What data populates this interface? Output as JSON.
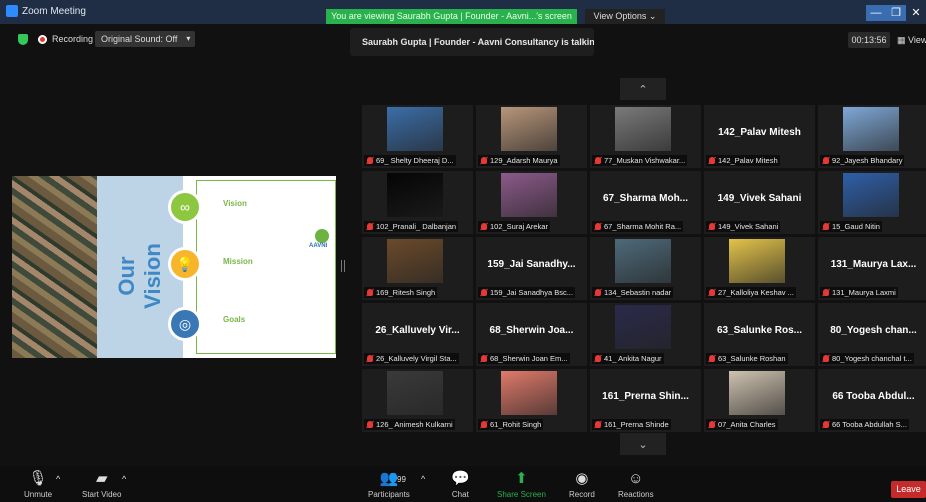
{
  "window": {
    "title": "Zoom Meeting",
    "banner": "You are viewing Saurabh Gupta | Founder - Aavni...'s screen",
    "view_options": "View Options",
    "minimize": "—",
    "maximize": "❐",
    "close": "✕"
  },
  "header": {
    "recording": "Recording",
    "original_sound": "Original Sound: Off",
    "talking": "Saurabh Gupta | Founder - Aavni Consultancy is talking...",
    "timer": "00:13:56",
    "view": "View"
  },
  "slide": {
    "title": "Our Vision",
    "brand": "AAVNI",
    "items": [
      {
        "title": "Vision",
        "icon": "binoculars-icon"
      },
      {
        "title": "Mission",
        "icon": "lightbulb-icon"
      },
      {
        "title": "Goals",
        "icon": "target-icon"
      }
    ]
  },
  "gallery": {
    "up": "⌃",
    "down": "⌄",
    "tiles": [
      {
        "name": "69_ Shelty Dheeraj D...",
        "photo": "#3b6ea8"
      },
      {
        "name": "129_Adarsh Maurya",
        "photo": "#b8967a"
      },
      {
        "name": "77_Muskan Vishwakar...",
        "photo": "#7a7a7a"
      },
      {
        "name": "142_Palav Mitesh",
        "big": "142_Palav Mitesh"
      },
      {
        "name": "92_Jayesh Bhandary",
        "photo": "#7fa8d6"
      },
      {
        "name": "102_Pranali_ Dalbanjan",
        "photo": "#050505"
      },
      {
        "name": "102_Suraj Arekar",
        "photo": "#8c5a8a"
      },
      {
        "name": "67_Sharma Mohit Ra...",
        "big": "67_Sharma Moh..."
      },
      {
        "name": "149_Vivek Sahani",
        "big": "149_Vivek Sahani"
      },
      {
        "name": "15_Gaud Nitin",
        "photo": "#2f5fa8"
      },
      {
        "name": "169_Ritesh Singh",
        "photo": "#6b4a2a"
      },
      {
        "name": "159_Jai Sanadhya Bsc...",
        "big": "159_Jai Sanadhy..."
      },
      {
        "name": "134_Sebastin nadar",
        "photo": "#4e6a7a"
      },
      {
        "name": "27_Kalloliya Keshav ...",
        "photo": "#e3c34a"
      },
      {
        "name": "131_Maurya Laxmi",
        "big": "131_Maurya Lax..."
      },
      {
        "name": "26_Kalluvely Virgil Sta...",
        "big": "26_Kalluvely Vir..."
      },
      {
        "name": "68_Sherwin Joan Em...",
        "big": "68_Sherwin Joa..."
      },
      {
        "name": "41_ Ankita Nagur",
        "photo": "#2a2a4a"
      },
      {
        "name": "63_Salunke Roshan",
        "big": "63_Salunke Ros..."
      },
      {
        "name": "80_Yogesh chanchal t...",
        "big": "80_Yogesh chan..."
      },
      {
        "name": "126_ Animesh Kulkarni",
        "photo": "#3a3a3a"
      },
      {
        "name": "61_Rohit Singh",
        "photo": "#e07a6a"
      },
      {
        "name": "161_Prerna Shinde",
        "big": "161_Prerna Shin..."
      },
      {
        "name": "07_Anita Charles",
        "photo": "#cfc2b0"
      },
      {
        "name": "66 Tooba Abdullah S...",
        "big": "66 Tooba Abdul..."
      }
    ]
  },
  "toolbar": {
    "unmute": "Unmute",
    "start_video": "Start Video",
    "participants": "Participants",
    "participant_count": "99",
    "chat": "Chat",
    "share_screen": "Share Screen",
    "record": "Record",
    "reactions": "Reactions",
    "leave": "Leave"
  }
}
